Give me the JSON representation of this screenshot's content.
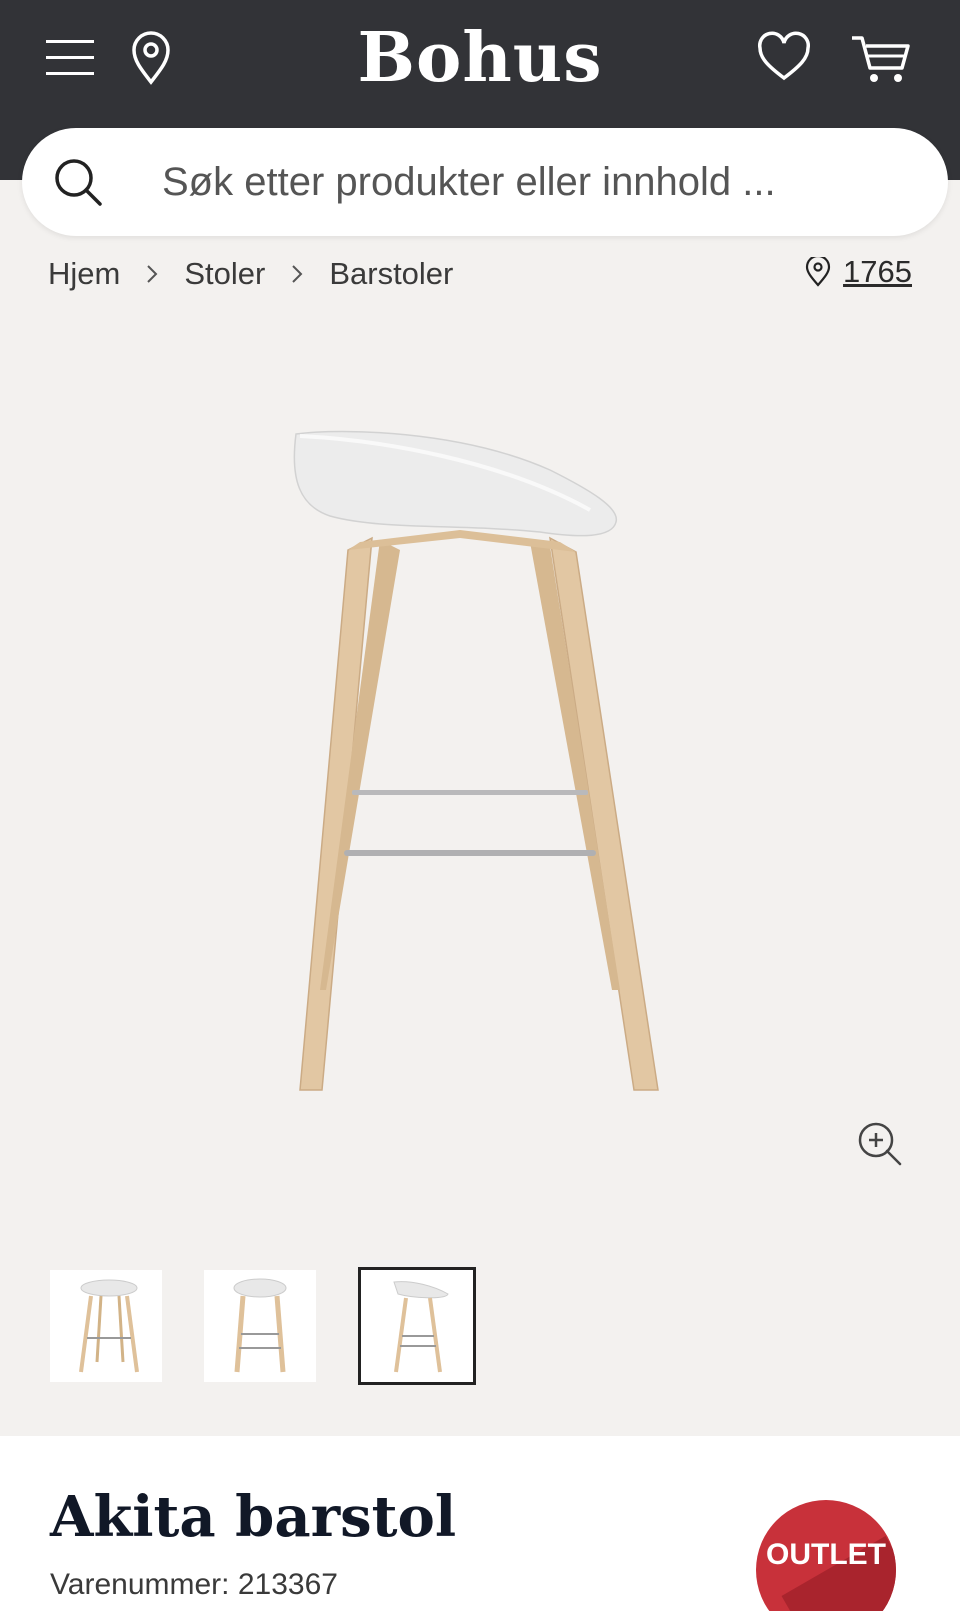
{
  "header": {
    "logo": "Bohus",
    "icons": [
      "menu-icon",
      "location-icon",
      "heart-icon",
      "cart-icon"
    ],
    "background": "#323337"
  },
  "search": {
    "placeholder": "Søk etter produkter eller innhold ..."
  },
  "breadcrumb": {
    "items": [
      "Hjem",
      "Stoler",
      "Barstoler"
    ]
  },
  "store": {
    "number": "1765"
  },
  "gallery": {
    "thumbnail_count": 3,
    "active_thumbnail": 3
  },
  "product": {
    "title": "Akita barstol",
    "sku_label": "Varenummer:",
    "sku_value": "213367",
    "badge": "OUTLET",
    "badge_color": "#c8313a"
  }
}
